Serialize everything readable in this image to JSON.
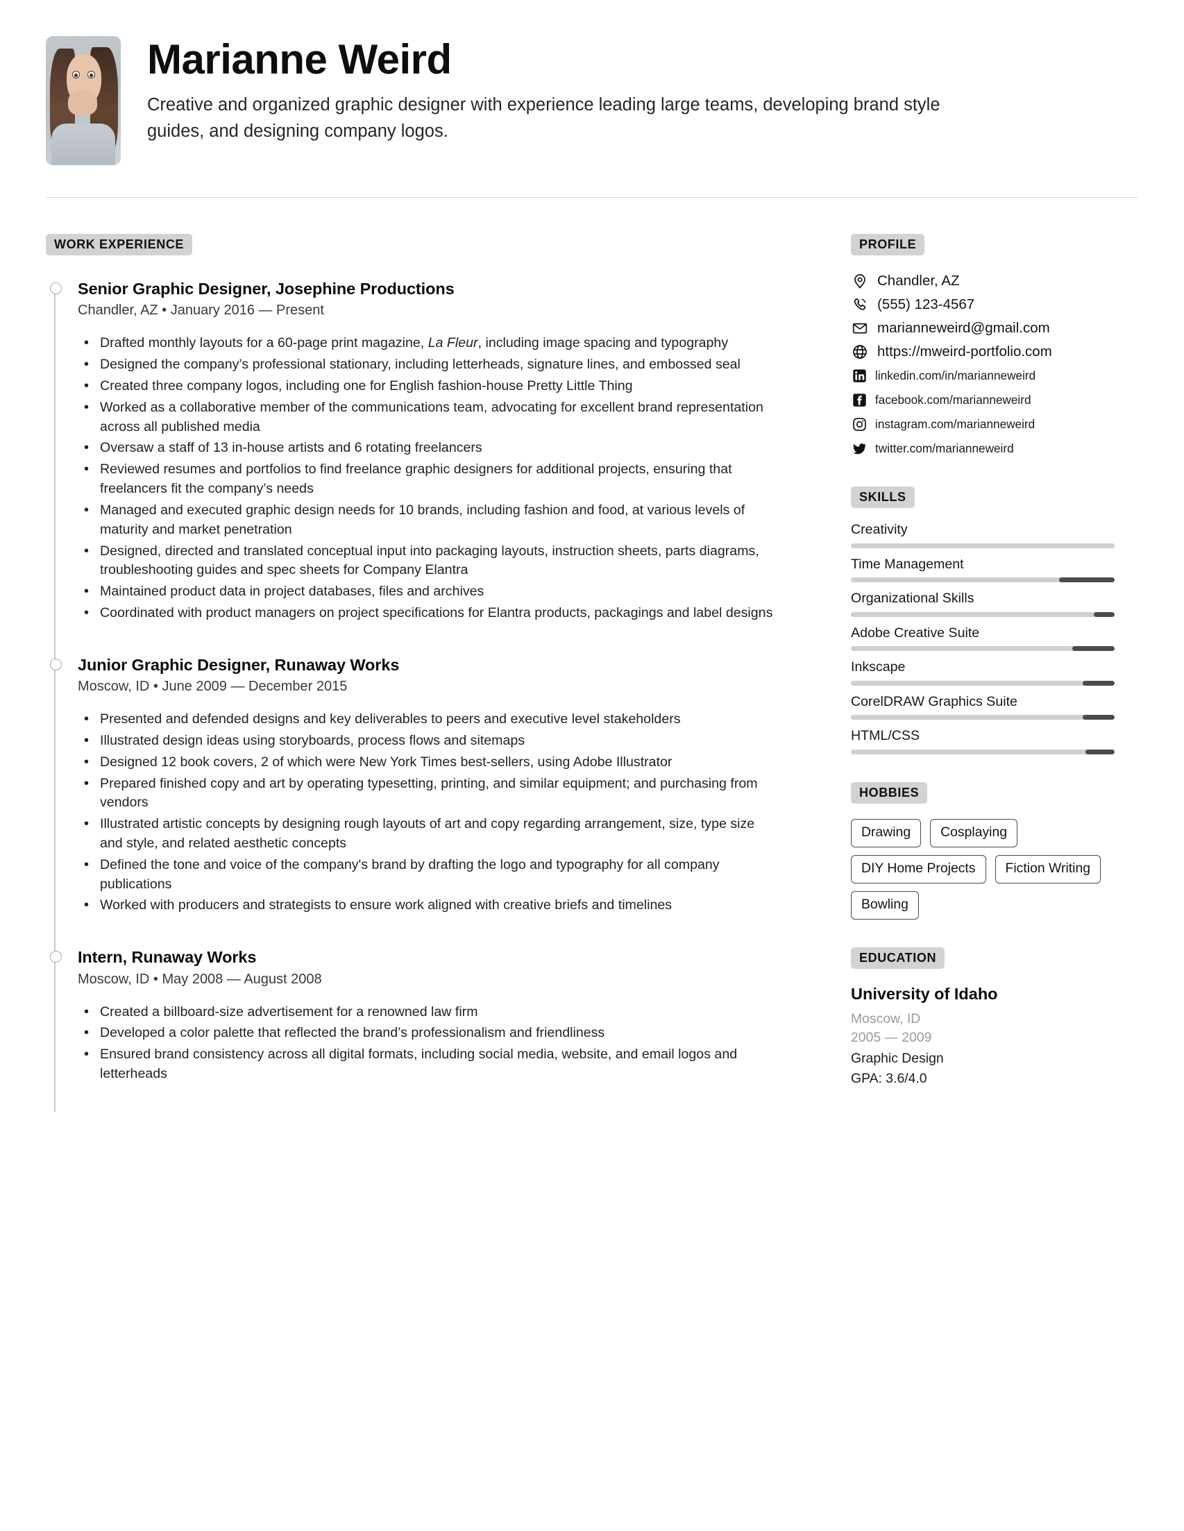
{
  "header": {
    "name": "Marianne Weird",
    "tagline": "Creative and organized graphic designer with experience leading large teams, developing brand style guides, and designing company logos.",
    "avatar_alt": "portrait-photo"
  },
  "work": {
    "section_title": "WORK EXPERIENCE",
    "jobs": [
      {
        "title": "Senior Graphic Designer, Josephine Productions",
        "meta": "Chandler, AZ • January 2016 — Present",
        "bullets": [
          "Drafted monthly layouts for a 60-page print magazine, La Fleur, including image spacing and typography",
          "Designed the company’s professional stationary, including letterheads, signature lines, and embossed seal",
          "Created three company logos, including one for English fashion-house Pretty Little Thing",
          "Worked as a collaborative member of the communications team, advocating for excellent brand representation across all published media",
          "Oversaw a staff of 13 in-house artists and 6 rotating freelancers",
          "Reviewed resumes and portfolios to find freelance graphic designers for additional projects, ensuring that freelancers fit the company’s needs",
          "Managed and executed graphic design needs for 10 brands, including fashion and food, at various levels of maturity and market penetration",
          "Designed, directed and translated conceptual input into packaging layouts, instruction sheets, parts diagrams, troubleshooting guides and spec sheets for Company Elantra",
          "Maintained product data in project databases, files and archives",
          "Coordinated with product managers on project specifications for Elantra products, packagings and label designs"
        ]
      },
      {
        "title": "Junior Graphic Designer, Runaway Works",
        "meta": "Moscow, ID • June 2009 — December 2015",
        "bullets": [
          "Presented and defended designs and key deliverables to peers and executive level stakeholders",
          "Illustrated design ideas using storyboards, process flows and sitemaps",
          "Designed 12 book covers, 2 of which were New York Times best-sellers, using Adobe Illustrator",
          "Prepared finished copy and art by operating typesetting, printing, and similar equipment; and purchasing from vendors",
          "Illustrated artistic concepts by designing rough layouts of art and copy regarding arrangement, size, type size and style, and related aesthetic concepts",
          "Defined the tone and voice of the company's brand by drafting the logo and typography for all company publications",
          "Worked with producers and strategists to ensure work aligned with creative briefs and timelines"
        ]
      },
      {
        "title": "Intern, Runaway Works",
        "meta": "Moscow, ID • May 2008 — August 2008",
        "bullets": [
          "Created a billboard-size advertisement for a renowned law firm",
          "Developed a color palette that reflected the brand’s professionalism and friendliness",
          "Ensured brand consistency across all digital formats, including social media, website, and email logos and letterheads"
        ]
      }
    ]
  },
  "profile": {
    "section_title": "PROFILE",
    "contacts": [
      {
        "icon": "location-pin-icon",
        "text": "Chandler, AZ",
        "style": "primary"
      },
      {
        "icon": "phone-icon",
        "text": "(555) 123-4567",
        "style": "primary"
      },
      {
        "icon": "envelope-icon",
        "text": "marianneweird@gmail.com",
        "style": "primary"
      },
      {
        "icon": "globe-icon",
        "text": "https://mweird-portfolio.com",
        "style": "primary"
      },
      {
        "icon": "linkedin-icon",
        "text": "linkedin.com/in/marianneweird",
        "style": "social"
      },
      {
        "icon": "facebook-icon",
        "text": "facebook.com/marianneweird",
        "style": "social"
      },
      {
        "icon": "instagram-icon",
        "text": "instagram.com/marianneweird",
        "style": "social"
      },
      {
        "icon": "twitter-icon",
        "text": "twitter.com/marianneweird",
        "style": "social"
      }
    ]
  },
  "skills": {
    "section_title": "SKILLS",
    "items": [
      {
        "name": "Creativity",
        "knob_percent": 0
      },
      {
        "name": "Time Management",
        "knob_percent": 21
      },
      {
        "name": "Organizational Skills",
        "knob_percent": 8
      },
      {
        "name": "Adobe Creative Suite",
        "knob_percent": 16
      },
      {
        "name": "Inkscape",
        "knob_percent": 12
      },
      {
        "name": "CorelDRAW Graphics Suite",
        "knob_percent": 12
      },
      {
        "name": "HTML/CSS",
        "knob_percent": 11
      }
    ]
  },
  "hobbies": {
    "section_title": "HOBBIES",
    "items": [
      "Drawing",
      "Cosplaying",
      "DIY Home Projects",
      "Fiction Writing",
      "Bowling"
    ]
  },
  "education": {
    "section_title": "EDUCATION",
    "school": "University of Idaho",
    "location": "Moscow, ID",
    "years": "2005 — 2009",
    "major": "Graphic Design",
    "gpa": "GPA: 3.6/4.0"
  },
  "colors": {
    "chip_background": "#d2d2d2",
    "skill_track": "#cfcfcf",
    "skill_knob": "#4b4b4b",
    "timeline_line": "#c9c9c9",
    "muted_text": "#9a9a9a"
  }
}
